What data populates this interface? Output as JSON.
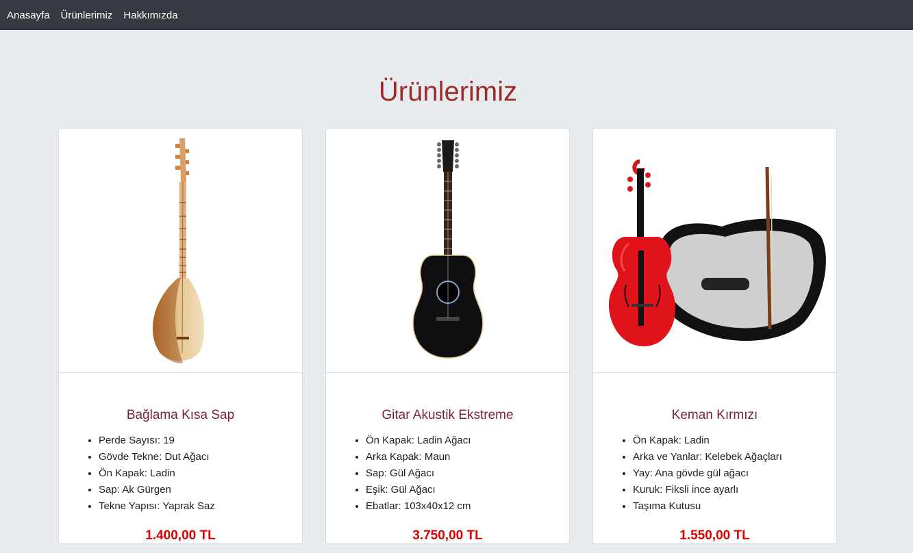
{
  "nav": {
    "items": [
      "Anasayfa",
      "Ürünlerimiz",
      "Hakkımızda"
    ]
  },
  "page": {
    "title": "Ürünlerimiz"
  },
  "products": [
    {
      "name": "Bağlama Kısa Sap",
      "image_icon": "baglama-icon",
      "specs": [
        "Perde Sayısı: 19",
        "Gövde Tekne: Dut Ağacı",
        "Ön Kapak: Ladin",
        "Sap: Ak Gürgen",
        "Tekne Yapısı: Yaprak Saz"
      ],
      "price": "1.400,00 TL"
    },
    {
      "name": "Gitar Akustik Ekstreme",
      "image_icon": "acoustic-guitar-icon",
      "specs": [
        "Ön Kapak: Ladin Ağacı",
        "Arka Kapak: Maun",
        "Sap: Gül Ağacı",
        "Eşik: Gül Ağacı",
        "Ebatlar: 103x40x12 cm"
      ],
      "price": "3.750,00 TL"
    },
    {
      "name": "Keman Kırmızı",
      "image_icon": "violin-icon",
      "specs": [
        "Ön Kapak: Ladin",
        "Arka ve Yanlar: Kelebek Ağaçları",
        "Yay: Ana gövde gül ağacı",
        "Kuruk: Fiksli ince ayarlı",
        "Taşıma Kutusu"
      ],
      "price": "1.550,00 TL"
    }
  ],
  "colors": {
    "navbar": "#343a40",
    "background": "#e9ecef",
    "title": "#9b2c2c",
    "card_title": "#7a1f3a",
    "price": "#dc0000"
  }
}
